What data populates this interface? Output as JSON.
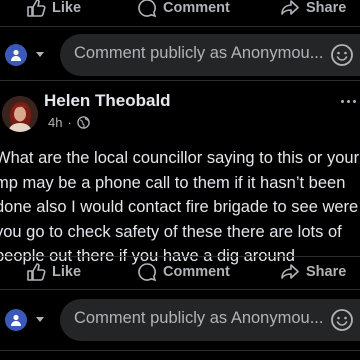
{
  "top_actions": {
    "like": "Like",
    "comment": "Comment",
    "share": "Share"
  },
  "composer": {
    "placeholder": "Comment publicly as Anonymou..."
  },
  "post": {
    "author": "Helen Theobald",
    "time": "4h",
    "lines": [
      "What are the local councillor saying to this or your",
      "mp may be a phone call to them if it hasn’t been",
      "done also I would contact fire brigade to see were",
      "you go to check safety of these there are lots of",
      "people out there if you have a dig around"
    ]
  },
  "bottom_actions": {
    "like": "Like",
    "comment": "Comment",
    "share": "Share"
  },
  "composer2": {
    "placeholder": "Comment publicly as Anonymou..."
  },
  "icons": [
    "like-icon",
    "comment-icon",
    "share-icon",
    "avatar-group-icon",
    "caret-down-icon",
    "emoji-icon",
    "globe-icon",
    "more-icon"
  ],
  "colors": {
    "background": "#000000",
    "text": "#e4e6eb",
    "muted": "#b0b3b8",
    "input": "#242526",
    "avatar": "#3a59b8"
  }
}
